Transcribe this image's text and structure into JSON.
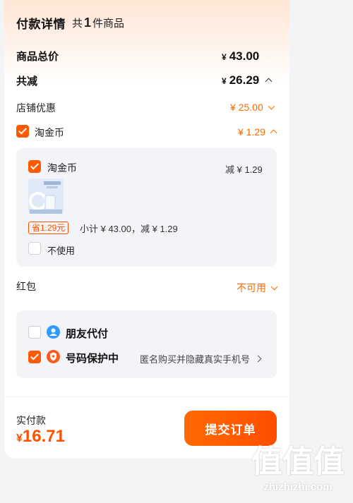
{
  "header": {
    "title": "付款详情",
    "count_prefix": "共",
    "count": "1",
    "count_suffix": "件商品"
  },
  "summary": {
    "goods_total_label": "商品总价",
    "goods_total_currency": "¥",
    "goods_total_value": "43.00",
    "discount_label": "共减",
    "discount_currency": "¥",
    "discount_value": "26.29",
    "shop_discount_label": "店铺优惠",
    "shop_discount_value": "¥ 25.00",
    "coin_label": "淘金币",
    "coin_value": "¥ 1.29"
  },
  "coin_panel": {
    "item_label": "淘金币",
    "reduce_text": "减 ¥ 1.29",
    "save_tag": "省1.29元",
    "subtotal_text": "小计 ¥ 43.00，减 ¥ 1.29",
    "not_use_label": "不使用"
  },
  "red_packet": {
    "label": "红包",
    "status": "不可用"
  },
  "options": {
    "friend_pay_label": "朋友代付",
    "privacy_label": "号码保护中",
    "privacy_desc": "匿名购买并隐藏真实手机号"
  },
  "footer": {
    "paid_label": "实付款",
    "paid_currency": "¥",
    "paid_value": "16.71",
    "submit_label": "提交订单"
  },
  "watermark": {
    "mark": "值值值",
    "site": "zhizhizhi.com"
  },
  "colors": {
    "accent": "#ff5000",
    "panel_bg": "#f2f4f8",
    "friend_icon": "#2f9bff",
    "shield_icon": "#ff5a1f"
  }
}
